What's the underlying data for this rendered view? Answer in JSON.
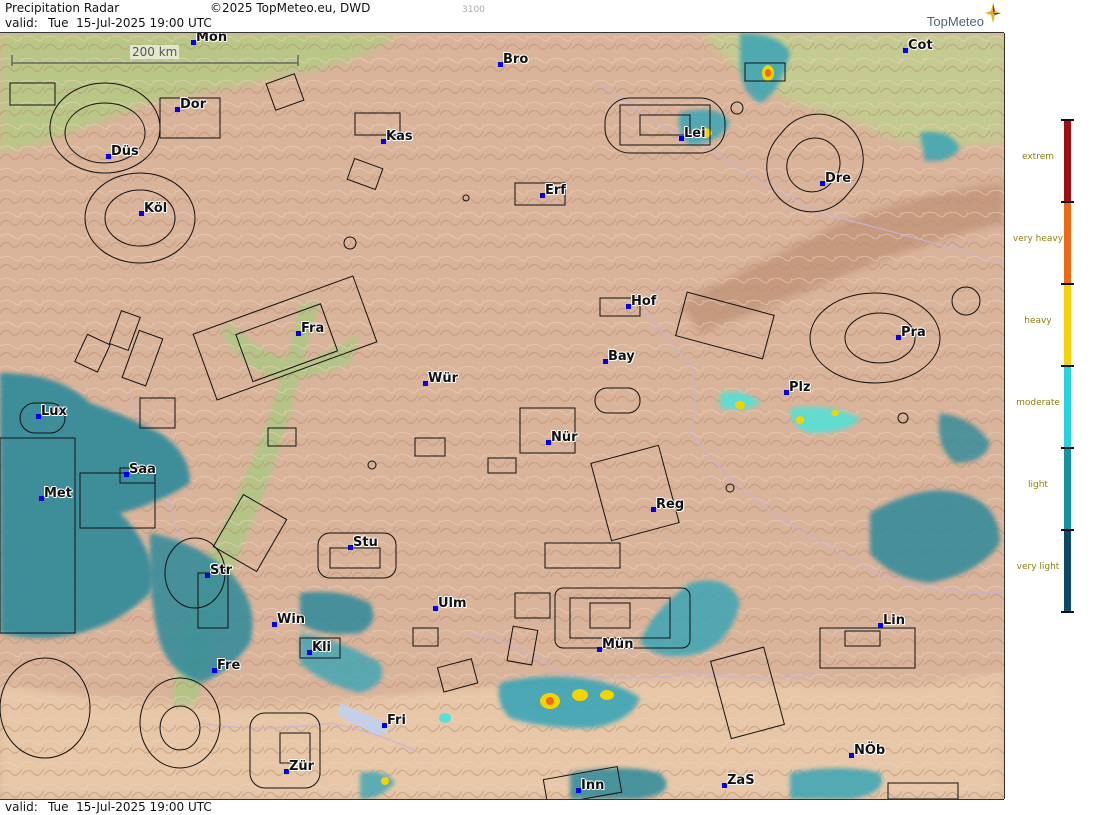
{
  "header": {
    "title": "Precipitation Radar",
    "copyright": "©2025 TopMeteo.eu, DWD",
    "code": "3100",
    "valid_label": "valid:",
    "valid_value": "Tue  15-Jul-2025 19:00 UTC",
    "brand": "TopMeteo"
  },
  "footer": {
    "valid_label": "valid:",
    "valid_value": "Tue  15-Jul-2025 19:00 UTC"
  },
  "scale": {
    "label": "200 km"
  },
  "legend": {
    "items": [
      {
        "label": "extrem",
        "color": "#a10f14"
      },
      {
        "label": "very heavy",
        "color": "#ee6a16"
      },
      {
        "label": "heavy",
        "color": "#f6d20b"
      },
      {
        "label": "moderate",
        "color": "#27d3e0"
      },
      {
        "label": "light",
        "color": "#1593a6"
      },
      {
        "label": "very light",
        "color": "#0d4a6a"
      }
    ]
  },
  "colors": {
    "land": "#dbb49a",
    "lowland": "#b9c986",
    "mountain": "#c79f85",
    "alps": "#e9c9a8",
    "rain_very_light": "#2e7f90",
    "rain_light": "#3ab0c4",
    "rain_moderate": "#56e0d6",
    "rain_heavy": "#f4d400",
    "rain_very_heavy": "#ee6a16"
  },
  "cities": [
    {
      "name": "Mon"
    },
    {
      "name": "Bro"
    },
    {
      "name": "Cot"
    },
    {
      "name": "Dor"
    },
    {
      "name": "Lei"
    },
    {
      "name": "Kas"
    },
    {
      "name": "Düs"
    },
    {
      "name": "Dre"
    },
    {
      "name": "Erf"
    },
    {
      "name": "Köl"
    },
    {
      "name": "Hof"
    },
    {
      "name": "Fra"
    },
    {
      "name": "Pra"
    },
    {
      "name": "Bay"
    },
    {
      "name": "Wür"
    },
    {
      "name": "Plz"
    },
    {
      "name": "Lux"
    },
    {
      "name": "Nür"
    },
    {
      "name": "Saa"
    },
    {
      "name": "Met"
    },
    {
      "name": "Reg"
    },
    {
      "name": "Stu"
    },
    {
      "name": "Str"
    },
    {
      "name": "Ulm"
    },
    {
      "name": "Win"
    },
    {
      "name": "Lin"
    },
    {
      "name": "Kli"
    },
    {
      "name": "Mün"
    },
    {
      "name": "Fre"
    },
    {
      "name": "Fri"
    },
    {
      "name": "NÖb"
    },
    {
      "name": "Zür"
    },
    {
      "name": "ZaS"
    },
    {
      "name": "Inn"
    }
  ]
}
